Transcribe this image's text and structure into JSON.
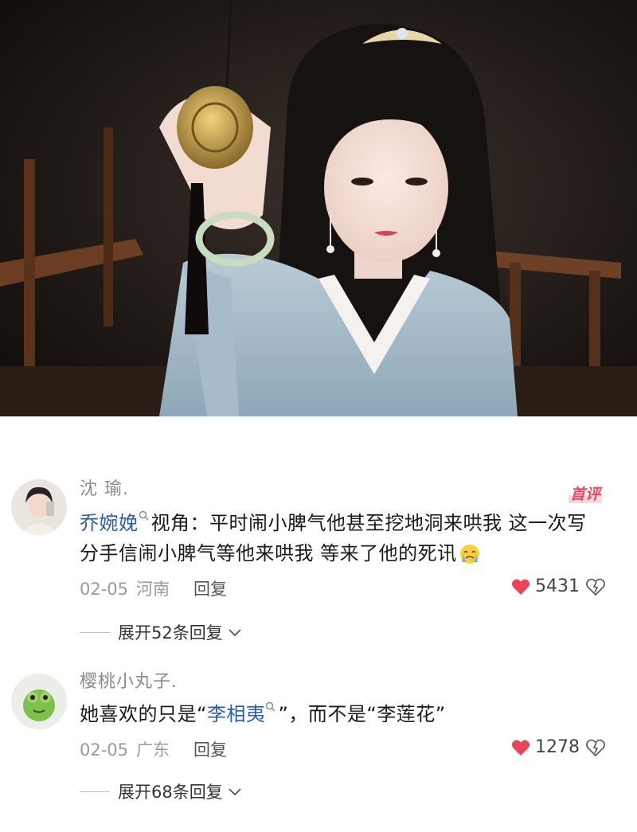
{
  "hero": {
    "alt_icon": "costume-drama-still"
  },
  "comments": [
    {
      "user": "沈 瑜.",
      "badge": "首评",
      "mention": "乔婉娩",
      "text_after_mention": "视角：平时闹小脾气他甚至挖地洞来哄我 这一次写分手信闹小脾气等他来哄我 等来了他的死讯",
      "emoji": "crying-emoji",
      "date": "02-05",
      "location": "河南",
      "reply_label": "回复",
      "likes": "5431",
      "expand_label": "展开52条回复"
    },
    {
      "user": "樱桃小丸子.",
      "text_before_mention": "她喜欢的只是“",
      "mention": "李相夷",
      "text_after_mention": "”，而不是“李莲花”",
      "date": "02-05",
      "location": "广东",
      "reply_label": "回复",
      "likes": "1278",
      "expand_label": "展开68条回复"
    }
  ],
  "colors": {
    "mention": "#2d5da6",
    "heart": "#e8455a",
    "badge": "#e84a5f"
  }
}
